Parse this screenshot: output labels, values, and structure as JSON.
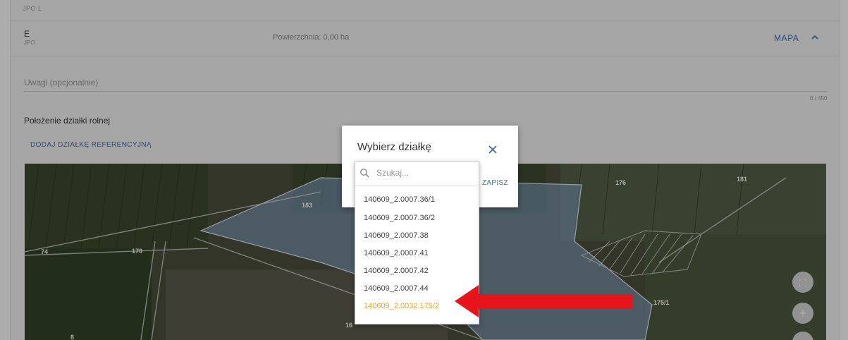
{
  "top_strip": {
    "label": "JPO L"
  },
  "section_e": {
    "title": "E",
    "subtitle": "JPO",
    "area": "Powierzchnia: 0,00 ha",
    "map_link": "MAPA"
  },
  "notes": {
    "placeholder": "Uwagi (opcjonalnie)",
    "counter": "0 / 450"
  },
  "location": {
    "heading": "Położenie działki rolnej",
    "add_reference_label": "DODAJ DZIAŁKĘ REFERENCYJNĄ"
  },
  "map": {
    "labels": [
      "183",
      "176",
      "181",
      "74",
      "170",
      "175/1",
      "16",
      "8"
    ],
    "buttons": {
      "fullscreen": "⛶",
      "zoom_in": "+"
    }
  },
  "dialog": {
    "title": "Wybierz działkę",
    "close": "✕",
    "save_label": "ZAPISZ",
    "search_placeholder": "Szukaj...",
    "options": [
      "140609_2.0007.36/1",
      "140609_2.0007.36/2",
      "140609_2.0007.38",
      "140609_2.0007.41",
      "140609_2.0007.42",
      "140609_2.0007.44",
      "140609_2.0032.175/2"
    ],
    "highlighted_index": 6
  },
  "colors": {
    "accent": "#3f6fb6",
    "highlight": "#f0a429",
    "arrow": "#e8141b",
    "parcel": "#8fb3df"
  }
}
